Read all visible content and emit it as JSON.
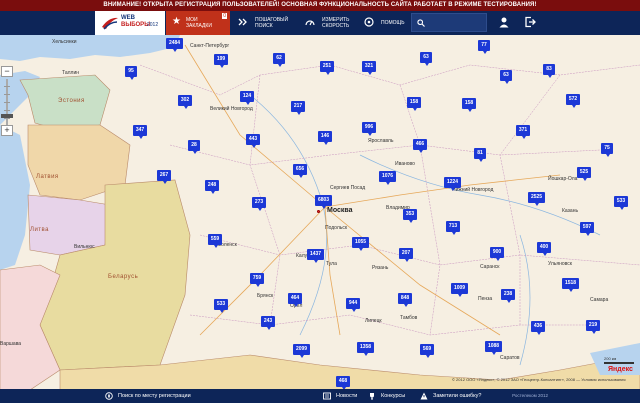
{
  "notice": "ВНИМАНИЕ! ОТКРЫТА РЕГИСТРАЦИЯ ПОЛЬЗОВАТЕЛЕЙ! ОСНОВНАЯ ФУНКЦИОНАЛЬНОСТЬ САЙТА РАБОТАЕТ В РЕЖИМЕ ТЕСТИРОВАНИЯ!",
  "logo": {
    "line1": "WEB",
    "line2": "ВЫБОРЫ",
    "year": "2012"
  },
  "nav": {
    "bookmarks_label": "МОИ ЗАКЛАДКИ",
    "bookmarks_count": "0",
    "step_search": "ПОШАГОВЫЙ ПОИСК",
    "measure_speed": "ИЗМЕРИТЬ СКОРОСТЬ",
    "help": "ПОМОЩЬ"
  },
  "search": {
    "placeholder": ""
  },
  "map": {
    "cities": [
      {
        "name": "Хельсинки"
      },
      {
        "name": "Санкт-Петербург"
      },
      {
        "name": "Таллин"
      },
      {
        "name": "Эстония"
      },
      {
        "name": "Латвия"
      },
      {
        "name": "Литва"
      },
      {
        "name": "Вильнюс"
      },
      {
        "name": "Беларусь"
      },
      {
        "name": "Великий Новгород"
      },
      {
        "name": "Ярославль"
      },
      {
        "name": "Иваново"
      },
      {
        "name": "Нижний Новгород"
      },
      {
        "name": "Владимир"
      },
      {
        "name": "Москва"
      },
      {
        "name": "Тула"
      },
      {
        "name": "Брянск"
      },
      {
        "name": "Орёл"
      },
      {
        "name": "Липецк"
      },
      {
        "name": "Тамбов"
      },
      {
        "name": "Пенза"
      },
      {
        "name": "Саранск"
      },
      {
        "name": "Казань"
      },
      {
        "name": "Ульяновск"
      },
      {
        "name": "Самара"
      },
      {
        "name": "Саратов"
      },
      {
        "name": "Йошкар-Ола"
      },
      {
        "name": "Рязань"
      },
      {
        "name": "Калуга"
      },
      {
        "name": "Смоленск"
      },
      {
        "name": "Варшава"
      },
      {
        "name": "Сергиев Посад"
      },
      {
        "name": "Подольск"
      }
    ],
    "markers": [
      "2484",
      "199",
      "62",
      "251",
      "321",
      "63",
      "77",
      "95",
      "302",
      "124",
      "217",
      "158",
      "158",
      "63",
      "83",
      "572",
      "347",
      "28",
      "443",
      "146",
      "996",
      "466",
      "371",
      "81",
      "75",
      "267",
      "248",
      "656",
      "1076",
      "1224",
      "525",
      "273",
      "6803",
      "353",
      "713",
      "2525",
      "597",
      "533",
      "559",
      "1437",
      "1055",
      "207",
      "900",
      "400",
      "759",
      "464",
      "944",
      "848",
      "1009",
      "238",
      "1518",
      "533",
      "243",
      "436",
      "219",
      "2099",
      "1358",
      "569",
      "1088",
      "468"
    ],
    "copyright": "© 2012 ООО «Яндекс», © 2012 ЗАО «Геоцентр-Консалтинг», 2008 — Условия использования",
    "brand": "Яндекс",
    "scale": "200 км"
  },
  "bottom": {
    "search_by_reg": "Поиск по месту регистрации",
    "news": "Новости",
    "contests": "Конкурсы",
    "report_error": "Заметили ошибку?",
    "copyright": "Ростелеком 2012"
  },
  "colors": {
    "header": "#0d2558",
    "accent": "#c0311a",
    "marker": "#1c38d6",
    "notice": "#7a0d0d"
  }
}
